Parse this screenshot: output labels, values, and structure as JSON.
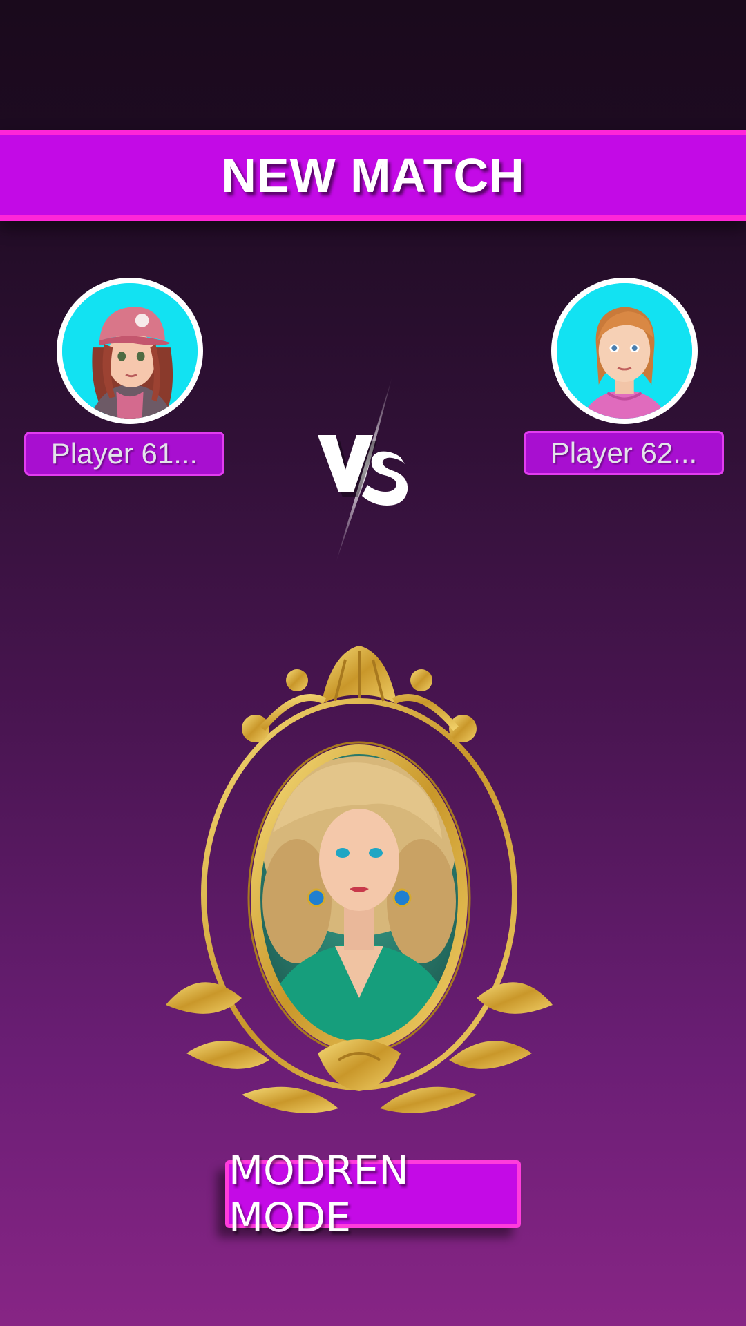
{
  "screen": {
    "title": "NEW MATCH"
  },
  "players": [
    {
      "name": "Player 61...",
      "avatar": "girl-cap-avatar"
    },
    {
      "name": "Player 62...",
      "avatar": "girl-ginger-avatar"
    }
  ],
  "versus": {
    "icon": "vs-icon"
  },
  "portrait": {
    "icon": "ornate-mirror-portrait"
  },
  "mode_button": {
    "label": "MODREN MODE"
  },
  "colors": {
    "banner": "#c30ae6",
    "banner_border": "#ff26d8",
    "avatar_bg": "#12e2f2",
    "frame_gold": "#d4a92e"
  }
}
